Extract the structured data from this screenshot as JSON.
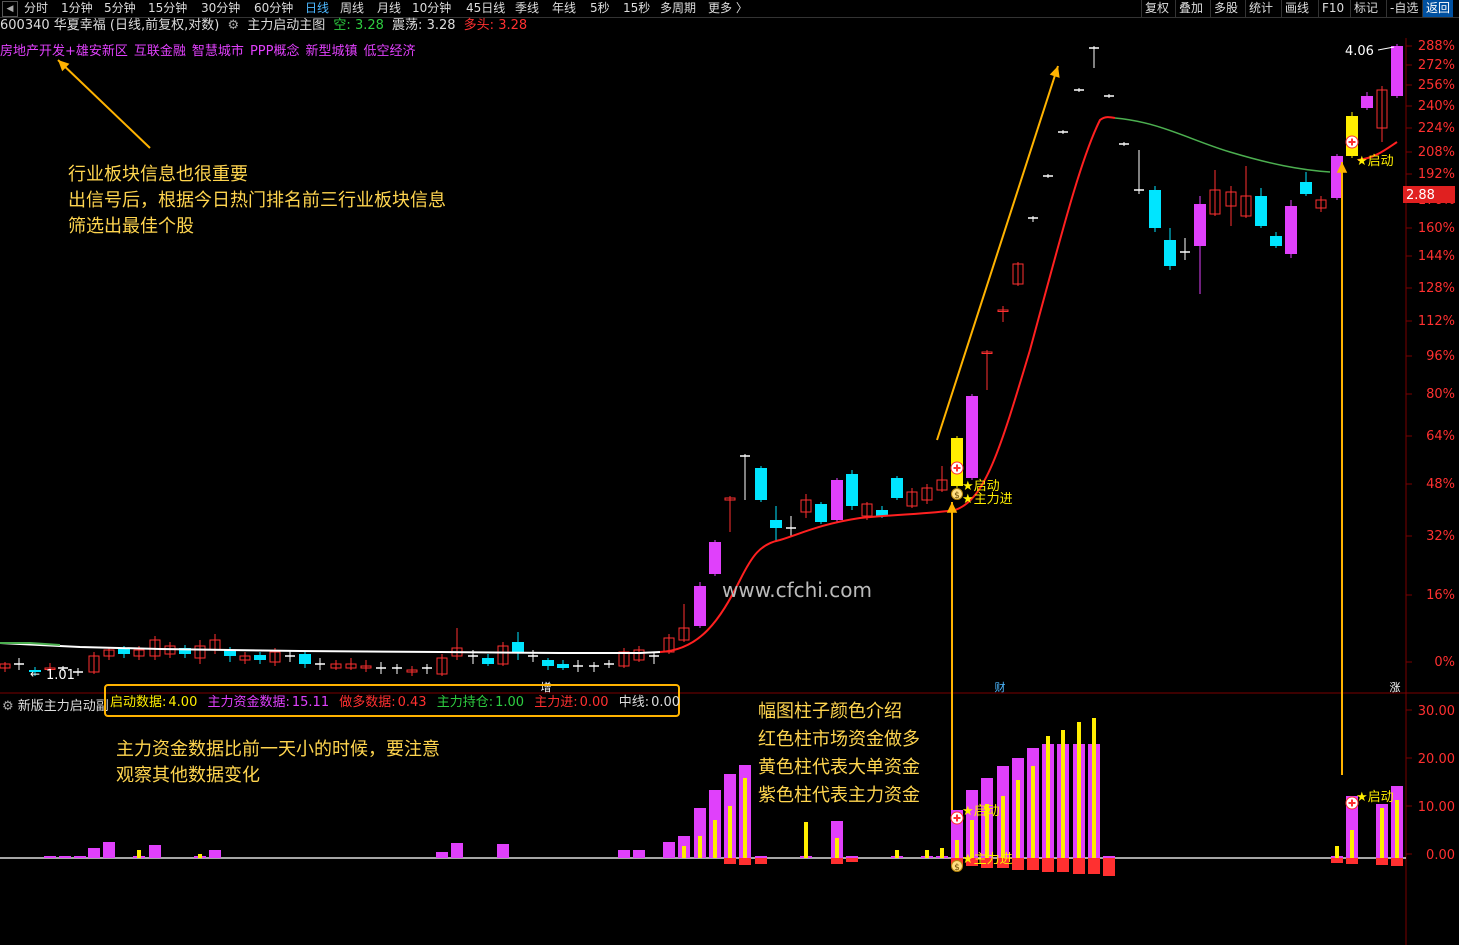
{
  "toolbar": {
    "periods": [
      {
        "label": "分时"
      },
      {
        "label": "1分钟"
      },
      {
        "label": "5分钟"
      },
      {
        "label": "15分钟"
      },
      {
        "label": "30分钟"
      },
      {
        "label": "60分钟"
      },
      {
        "label": "日线",
        "active": true
      },
      {
        "label": "周线"
      },
      {
        "label": "月线"
      },
      {
        "label": "10分钟"
      },
      {
        "label": "45日线"
      },
      {
        "label": "季线"
      },
      {
        "label": "年线"
      },
      {
        "label": "5秒"
      },
      {
        "label": "15秒"
      },
      {
        "label": "多周期"
      },
      {
        "label": "更多 〉"
      }
    ],
    "right_buttons": [
      "复权",
      "叠加",
      "多股",
      "统计",
      "画线",
      "F10",
      "标记",
      "-自选",
      "返回"
    ]
  },
  "info": {
    "code_name": "600340 华夏幸福",
    "mode": "(日线,前复权,对数)",
    "indicator": "主力启动主图",
    "kong_label": "空:",
    "kong_value": "3.28",
    "zhendang_label": "震荡:",
    "zhendang_value": "3.28",
    "duotou_label": "多头:",
    "duotou_value": "3.28"
  },
  "sectors": [
    "房地产开发+雄安新区",
    "互联金融",
    "智慧城市",
    "PPP概念",
    "新型城镇",
    "低空经济"
  ],
  "annotations": {
    "sector_note": [
      "行业板块信息也很重要",
      "出信号后，根据今日热门排名前三行业板块信息",
      "筛选出最佳个股"
    ],
    "fund_note": [
      "主力资金数据比前一天小的时候，要注意",
      "观察其他数据变化"
    ],
    "bar_note": [
      "幅图柱子颜色介绍",
      "红色柱市场资金做多",
      "黄色柱代表大单资金",
      "紫色柱代表主力资金"
    ]
  },
  "watermark": "www.cfchi.com",
  "price_axis": {
    "labels": [
      "288%",
      "272%",
      "256%",
      "240%",
      "224%",
      "208%",
      "192%",
      "176%",
      "160%",
      "144%",
      "128%",
      "112%",
      "96%",
      "80%",
      "64%",
      "48%",
      "32%",
      "16%",
      "0%"
    ],
    "current_price": "2.88"
  },
  "chart_labels": {
    "max_price": "4.06",
    "min_price": "1.01",
    "signal_qidong": "★启动",
    "signal_zhulijin": "★主力进",
    "marker_zeng": "增",
    "marker_cai": "财",
    "marker_zhang": "涨"
  },
  "sub_indicator": {
    "name": "新版主力启动副",
    "qidong_label": "启动数据:",
    "qidong_value": "4.00",
    "zjsj_label": "主力资金数据:",
    "zjsj_value": "15.11",
    "zdsj_label": "做多数据:",
    "zdsj_value": "0.43",
    "zlcc_label": "主力持仓:",
    "zlcc_value": "1.00",
    "zlj_label": "主力进:",
    "zlj_value": "0.00",
    "zx_label": "中线:",
    "zx_value": "0.00",
    "axis_labels": [
      "30.00",
      "20.00",
      "10.00",
      "0.00"
    ]
  },
  "colors": {
    "up": "#ff3030",
    "down": "#00e5ff",
    "magenta": "#e040fb",
    "yellow": "#ffee00",
    "orange": "#ffb300",
    "redline": "#ff2020",
    "greenline": "#4caf50"
  }
}
